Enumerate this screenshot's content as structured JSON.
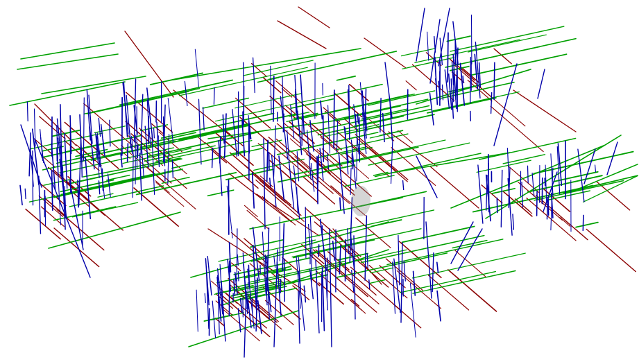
{
  "scene": {
    "background": "#ffffff",
    "axis_colors": {
      "x_axis_lines": "#8b0000",
      "y_axis_lines": "#00a000",
      "z_axis_lines": "#0000aa"
    },
    "marker_color": "#888888"
  }
}
